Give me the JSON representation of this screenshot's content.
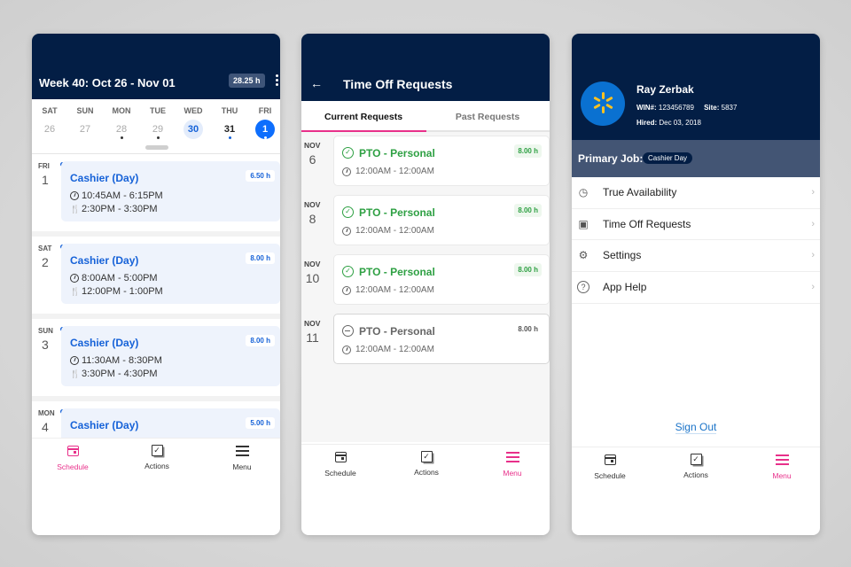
{
  "colors": {
    "navy": "#031e45",
    "accent_pink": "#e8308a",
    "blue": "#1662d8",
    "approved_green": "#2ea043",
    "walmart_yellow": "#ffc220",
    "walmart_blue": "#0a71d1"
  },
  "tabbar": {
    "schedule": "Schedule",
    "actions": "Actions",
    "menu": "Menu"
  },
  "schedule": {
    "header_title": "Week 40: Oct 26 - Nov 01",
    "total_hours": "28.25 h",
    "more_icon": "more-vertical-icon",
    "week_days": [
      {
        "name": "SAT",
        "num": "26",
        "state": "past",
        "dot": false
      },
      {
        "name": "SUN",
        "num": "27",
        "state": "past",
        "dot": false
      },
      {
        "name": "MON",
        "num": "28",
        "state": "past",
        "dot": true
      },
      {
        "name": "TUE",
        "num": "29",
        "state": "past",
        "dot": true
      },
      {
        "name": "WED",
        "num": "30",
        "state": "today",
        "dot": false
      },
      {
        "name": "THU",
        "num": "31",
        "state": "current",
        "dot": true
      },
      {
        "name": "FRI",
        "num": "1",
        "state": "selected",
        "dot": true
      }
    ],
    "shifts": [
      {
        "day_name": "FRI",
        "day_num": "1",
        "role": "Cashier (Day)",
        "hours": "6.50 h",
        "time": "10:45AM - 6:15PM",
        "meal": "2:30PM - 3:30PM"
      },
      {
        "day_name": "SAT",
        "day_num": "2",
        "role": "Cashier (Day)",
        "hours": "8.00 h",
        "time": "8:00AM - 5:00PM",
        "meal": "12:00PM - 1:00PM"
      },
      {
        "day_name": "SUN",
        "day_num": "3",
        "role": "Cashier (Day)",
        "hours": "8.00 h",
        "time": "11:30AM - 8:30PM",
        "meal": "3:30PM - 4:30PM"
      },
      {
        "day_name": "MON",
        "day_num": "4",
        "role": "Cashier (Day)",
        "hours": "5.00 h",
        "time": "",
        "meal": ""
      }
    ]
  },
  "time_off": {
    "title": "Time Off Requests",
    "tabs": [
      "Current Requests",
      "Past Requests"
    ],
    "requests": [
      {
        "month": "NOV",
        "day": "6",
        "type": "PTO - Personal",
        "hours": "8.00 h",
        "time": "12:00AM - 12:00AM",
        "status": "approved"
      },
      {
        "month": "NOV",
        "day": "8",
        "type": "PTO - Personal",
        "hours": "8.00 h",
        "time": "12:00AM - 12:00AM",
        "status": "approved"
      },
      {
        "month": "NOV",
        "day": "10",
        "type": "PTO - Personal",
        "hours": "8.00 h",
        "time": "12:00AM - 12:00AM",
        "status": "approved"
      },
      {
        "month": "NOV",
        "day": "11",
        "type": "PTO - Personal",
        "hours": "8.00 h",
        "time": "12:00AM - 12:00AM",
        "status": "pending"
      }
    ]
  },
  "profile": {
    "name": "Ray Zerbak",
    "win_label": "WIN#:",
    "win": "123456789",
    "site_label": "Site:",
    "site": "5837",
    "hired_label": "Hired:",
    "hired": "Dec 03, 2018",
    "primary_job_label": "Primary Job:",
    "primary_job": "Cashier Day",
    "menu_items": [
      {
        "label": "True Availability",
        "icon": "clock-icon"
      },
      {
        "label": "Time Off Requests",
        "icon": "calendar-check-icon"
      },
      {
        "label": "Settings",
        "icon": "gear-icon"
      },
      {
        "label": "App Help",
        "icon": "help-circle-icon"
      }
    ],
    "sign_out": "Sign Out"
  }
}
